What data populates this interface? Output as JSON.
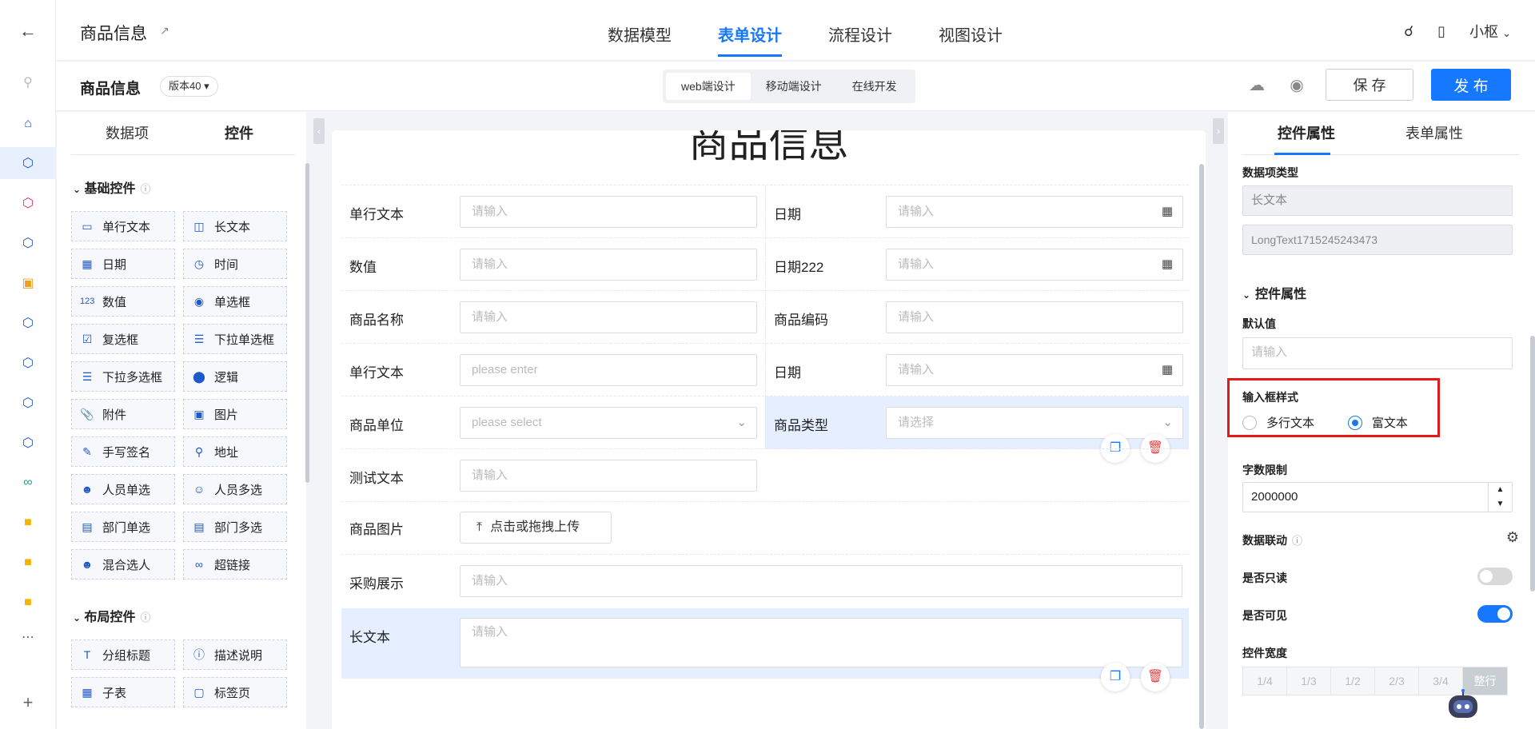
{
  "header": {
    "app_title": "商品信息",
    "tabs": [
      {
        "label": "数据模型"
      },
      {
        "label": "表单设计"
      },
      {
        "label": "流程设计"
      },
      {
        "label": "视图设计"
      }
    ],
    "user": "小枢"
  },
  "toolbar": {
    "form_name": "商品信息",
    "version": "版本40",
    "modes": [
      "web端设计",
      "移动端设计",
      "在线开发"
    ],
    "save_label": "保 存",
    "publish_label": "发 布"
  },
  "left_panel": {
    "tabs": [
      "数据项",
      "控件"
    ],
    "basic_group": "基础控件",
    "basic_controls": [
      {
        "label": "单行文本",
        "icon": "textbox-icon"
      },
      {
        "label": "长文本",
        "icon": "textarea-icon"
      },
      {
        "label": "日期",
        "icon": "calendar-icon"
      },
      {
        "label": "时间",
        "icon": "clock-icon"
      },
      {
        "label": "数值",
        "icon": "number-icon"
      },
      {
        "label": "单选框",
        "icon": "radio-icon"
      },
      {
        "label": "复选框",
        "icon": "checkbox-icon"
      },
      {
        "label": "下拉单选框",
        "icon": "dropdown-single-icon"
      },
      {
        "label": "下拉多选框",
        "icon": "dropdown-multi-icon"
      },
      {
        "label": "逻辑",
        "icon": "toggle-icon"
      },
      {
        "label": "附件",
        "icon": "attachment-icon"
      },
      {
        "label": "图片",
        "icon": "image-icon"
      },
      {
        "label": "手写签名",
        "icon": "signature-icon"
      },
      {
        "label": "地址",
        "icon": "location-icon"
      },
      {
        "label": "人员单选",
        "icon": "user-single-icon"
      },
      {
        "label": "人员多选",
        "icon": "user-multi-icon"
      },
      {
        "label": "部门单选",
        "icon": "dept-single-icon"
      },
      {
        "label": "部门多选",
        "icon": "dept-multi-icon"
      },
      {
        "label": "混合选人",
        "icon": "user-mixed-icon"
      },
      {
        "label": "超链接",
        "icon": "link-icon"
      }
    ],
    "layout_group": "布局控件",
    "layout_controls": [
      {
        "label": "分组标题",
        "icon": "group-title-icon"
      },
      {
        "label": "描述说明",
        "icon": "help-icon"
      },
      {
        "label": "子表",
        "icon": "table-icon"
      },
      {
        "label": "标签页",
        "icon": "tabs-icon"
      }
    ]
  },
  "canvas": {
    "title": "商品信息",
    "rows": [
      {
        "left": {
          "label": "单行文本",
          "placeholder": "请输入"
        },
        "right": {
          "label": "日期",
          "placeholder": "请输入"
        }
      },
      {
        "left": {
          "label": "数值",
          "placeholder": "请输入"
        },
        "right": {
          "label": "日期222",
          "placeholder": "请输入"
        }
      },
      {
        "left": {
          "label": "商品名称",
          "placeholder": "请输入"
        },
        "right": {
          "label": "商品编码",
          "placeholder": "请输入"
        }
      },
      {
        "left": {
          "label": "单行文本",
          "placeholder": "please enter"
        },
        "right": {
          "label": "日期",
          "placeholder": "请输入"
        }
      },
      {
        "left": {
          "label": "商品单位",
          "placeholder": "please select"
        },
        "right": {
          "label": "商品类型",
          "placeholder": "请选择"
        }
      },
      {
        "left": {
          "label": "测试文本",
          "placeholder": "请输入"
        }
      },
      {
        "left": {
          "label": "商品图片",
          "button": "点击或拖拽上传"
        }
      },
      {
        "left": {
          "label": "采购展示",
          "placeholder": "请输入"
        }
      },
      {
        "left": {
          "label": "长文本",
          "placeholder": "请输入"
        }
      }
    ]
  },
  "right_panel": {
    "tabs": [
      "控件属性",
      "表单属性"
    ],
    "data_type_label": "数据项类型",
    "data_type_value": "长文本",
    "field_code": "LongText1715245243473",
    "section_title": "控件属性",
    "default_label": "默认值",
    "default_placeholder": "请输入",
    "style_label": "输入框样式",
    "style_options": [
      "多行文本",
      "富文本"
    ],
    "style_selected": "富文本",
    "limit_label": "字数限制",
    "limit_value": "2000000",
    "linkage_label": "数据联动",
    "readonly_label": "是否只读",
    "readonly_on": false,
    "visible_label": "是否可见",
    "visible_on": true,
    "width_label": "控件宽度",
    "width_options": [
      "1/4",
      "1/3",
      "1/2",
      "2/3",
      "3/4",
      "整行"
    ],
    "width_selected": "整行"
  },
  "colors": {
    "accent": "#1677ff",
    "highlight": "#e61919"
  }
}
